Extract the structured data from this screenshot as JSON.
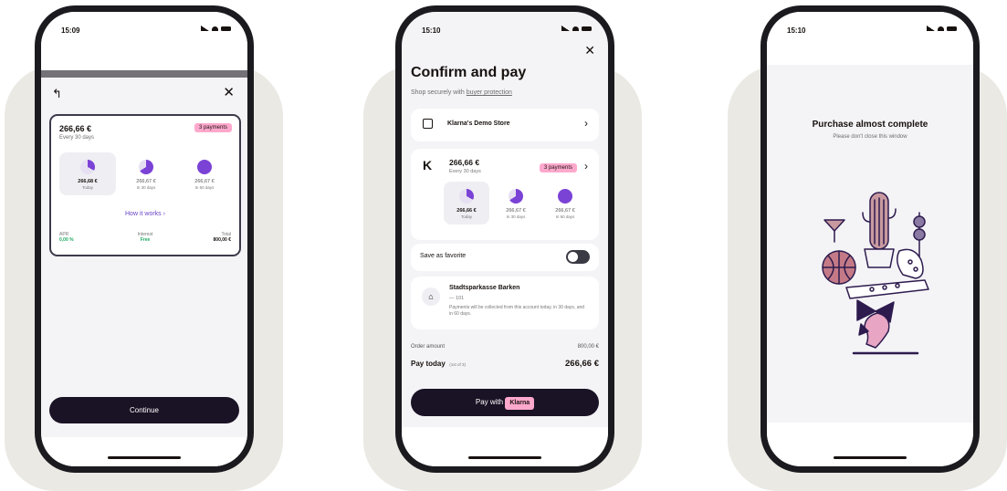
{
  "colors": {
    "accent": "#7b42d6",
    "pink": "#ffa8cd",
    "dark": "#1a1225",
    "backdrop": "#ebe9e4",
    "green": "#1fa860"
  },
  "phone1": {
    "time": "15:09",
    "back_icon": "back-arrow-icon",
    "close_icon": "close-icon",
    "amount": "266,66 €",
    "frequency": "Every 30 days",
    "badge": "3 payments",
    "installments": [
      {
        "amount": "266,68 €",
        "label": "Today"
      },
      {
        "amount": "266,67 €",
        "label": "In 30 days"
      },
      {
        "amount": "266,67 €",
        "label": "In 60 days"
      }
    ],
    "how_link": "How it works",
    "apr_label": "APR",
    "apr_value": "0,00 %",
    "interest_label": "Interest",
    "interest_value": "Free",
    "total_label": "Total",
    "total_value": "800,00 €",
    "continue_label": "Continue"
  },
  "phone2": {
    "time": "15:10",
    "title": "Confirm and pay",
    "subtitle_prefix": "Shop securely with",
    "subtitle_link": "buyer protection",
    "store": "Klarna's Demo Store",
    "amount": "266,66 €",
    "frequency": "Every 30 days",
    "badge": "3 payments",
    "installments": [
      {
        "amount": "266,66 €",
        "label": "Today"
      },
      {
        "amount": "266,67 €",
        "label": "In 30 days"
      },
      {
        "amount": "266,67 €",
        "label": "In 60 days"
      }
    ],
    "favorite_label": "Save as favorite",
    "favorite_on": false,
    "bank_name": "Stadtsparkasse Barken",
    "bank_account": "— 101",
    "bank_note": "Payments will be collected from this account today, in 30 days, and in 60 days.",
    "order_label": "Order amount",
    "order_value": "800,00 €",
    "pay_today_label": "Pay today",
    "pay_today_note": "(1st of 3)",
    "pay_today_value": "266,66 €",
    "pay_button_label": "Pay with",
    "pay_button_badge": "Klarna"
  },
  "phone3": {
    "time": "15:10",
    "title": "Purchase almost complete",
    "subtitle": "Please don't close this window"
  }
}
